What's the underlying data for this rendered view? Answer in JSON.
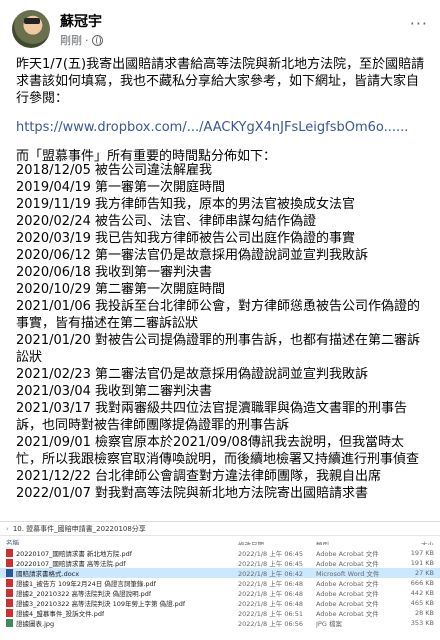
{
  "post": {
    "author": "蘇冠宇",
    "time": "剛剛",
    "more": "···",
    "intro": "昨天1/7(五)我寄出國賠請求書給高等法院與新北地方法院，至於國賠請求書該如何填寫，我也不藏私分享給大家參考，如下網址，皆請大家自行參閱：",
    "link": "https://www.dropbox.com/.../AACKYgX4nJFsLeigfsbOm6o......",
    "summary": "而「盟慕事件」所有重要的時間點分佈如下：",
    "timeline": [
      "2018/12/05 被告公司違法解雇我",
      "2019/04/19 第一審第一次開庭時間",
      "2019/11/19 我方律師告知我，原本的男法官被換成女法官",
      "2020/02/24 被告公司、法官、律師串謀勾結作偽證",
      "2020/03/19 我已告知我方律師被告公司出庭作偽證的事實",
      "2020/06/12 第一審法官仍是故意採用偽證說詞並宣判我敗訴",
      "2020/06/18 我收到第一審判決書",
      "2020/10/29 第二審第一次開庭時間",
      "2021/01/06 我投訴至台北律師公會，對方律師慫恿被告公司作偽證的事實，皆有描述在第二審訴訟狀",
      "2021/01/20 對被告公司提偽證罪的刑事告訴，也都有描述在第二審訴訟狀",
      "2021/02/23 第二審法官仍是故意採用偽證說詞並宣判我敗訴",
      "2021/03/04 我收到第二審判決書",
      "2021/03/17 我對兩審級共四位法官提瀆職罪與偽造文書罪的刑事告訴，也同時對被告律師團隊提偽證罪的刑事告訴",
      "2021/09/01 檢察官原本於2021/09/08傳訊我去說明，但我當時太忙，所以我跟檢察官取消傳喚說明，而後續地檢署又持續進行刑事偵查",
      "2021/12/22 台北律師公會調查對方違法律師團隊，我親自出席",
      "2022/01/07 對我對高等法院與新北地方法院寄出國賠請求書"
    ]
  },
  "explorer": {
    "path": "10. 盟慕事件_國賠申請書_20220108分享",
    "headers": [
      "名稱",
      "修改日期",
      "類型",
      "大小"
    ],
    "files": [
      {
        "icon": "pdf",
        "name": "20220107_國賠請求書 新北地方院.pdf",
        "date": "2022/1/8 上午 06:45",
        "type": "Adobe Acrobat 文件",
        "size": "197 KB"
      },
      {
        "icon": "pdf",
        "name": "20220107_國賠請求書 高等法院.pdf",
        "date": "2022/1/8 上午 06:45",
        "type": "Adobe Acrobat 文件",
        "size": "191 KB"
      },
      {
        "icon": "doc",
        "name": "國賠請求書格式.docx",
        "date": "2022/1/8 上午 06:42",
        "type": "Microsoft Word 文件",
        "size": "27 KB"
      },
      {
        "icon": "pdf",
        "name": "證據1_被告方 109年2月24日 偽證言詞筆錄.pdf",
        "date": "2022/1/8 上午 06:48",
        "type": "Adobe Acrobat 文件",
        "size": "666 KB"
      },
      {
        "icon": "pdf",
        "name": "證據2_20210322 高等法院判決 偽證說明.pdf",
        "date": "2022/1/8 上午 06:48",
        "type": "Adobe Acrobat 文件",
        "size": "442 KB"
      },
      {
        "icon": "pdf",
        "name": "證據3_20210322 高等法院判決 109年勞上字第 偽證.pdf",
        "date": "2022/1/8 上午 06:48",
        "type": "Adobe Acrobat 文件",
        "size": "465 KB"
      },
      {
        "icon": "pdf",
        "name": "證據4_盟慕事件_投訴文件.pdf",
        "date": "2022/1/8 上午 06:51",
        "type": "Adobe Acrobat 文件",
        "size": "28 KB"
      },
      {
        "icon": "jpg",
        "name": "證據圖表.jpg",
        "date": "2022/1/8 上午 06:56",
        "type": "JPG 檔案",
        "size": "353 KB"
      }
    ]
  }
}
